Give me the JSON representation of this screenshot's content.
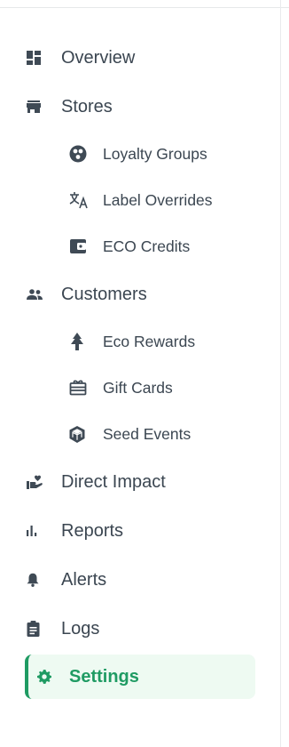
{
  "nav": {
    "overview": {
      "label": "Overview",
      "icon": "dashboard-icon"
    },
    "stores": {
      "label": "Stores",
      "icon": "store-icon"
    },
    "loyalty_groups": {
      "label": "Loyalty Groups",
      "icon": "groups-circle-icon"
    },
    "label_overrides": {
      "label": "Label Overrides",
      "icon": "translate-icon"
    },
    "eco_credits": {
      "label": "ECO Credits",
      "icon": "wallet-icon"
    },
    "customers": {
      "label": "Customers",
      "icon": "people-icon"
    },
    "eco_rewards": {
      "label": "Eco Rewards",
      "icon": "tree-icon"
    },
    "gift_cards": {
      "label": "Gift Cards",
      "icon": "gift-card-icon"
    },
    "seed_events": {
      "label": "Seed Events",
      "icon": "cube-icon"
    },
    "direct_impact": {
      "label": "Direct Impact",
      "icon": "hand-heart-icon"
    },
    "reports": {
      "label": "Reports",
      "icon": "bar-chart-icon"
    },
    "alerts": {
      "label": "Alerts",
      "icon": "bell-icon"
    },
    "logs": {
      "label": "Logs",
      "icon": "clipboard-icon"
    },
    "settings": {
      "label": "Settings",
      "icon": "gear-icon",
      "active": true
    }
  },
  "colors": {
    "accent": "#1f9b63",
    "active_bg": "#eefaf2",
    "text": "#3b4651"
  }
}
